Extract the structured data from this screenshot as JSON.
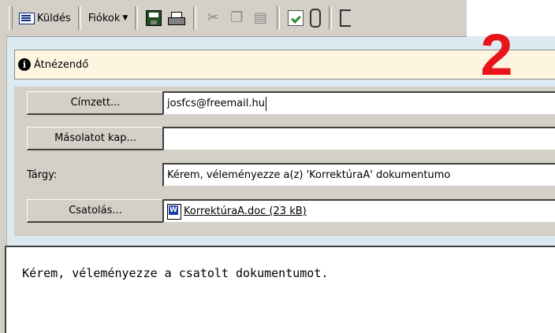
{
  "toolbar": {
    "send_label": "Küldés",
    "accounts_label": "Fiókok",
    "icons": [
      "send-envelope-icon",
      "save-icon",
      "print-icon",
      "cut-icon",
      "copy-icon",
      "paste-icon",
      "spellcheck-icon",
      "attach-icon"
    ]
  },
  "infobar": {
    "text": "Átnézendő"
  },
  "annotation_number": "2",
  "form": {
    "to_button": "Címzett...",
    "to_value": "josfcs@freemail.hu",
    "cc_button": "Másolatot kap...",
    "cc_value": "",
    "subject_label": "Tárgy:",
    "subject_value": "Kérem, véleményezze a(z) 'KorrektúraA' dokumentumo",
    "attach_button": "Csatolás...",
    "attachment": "KorrektúraA.doc (23 kB)"
  },
  "body": {
    "text": "Kérem, véleményezze a csatolt dokumentumot."
  },
  "colors": {
    "annotation": "#e8141c",
    "toolbar": "#d4d0c8",
    "infobar": "#fdf5e0"
  }
}
